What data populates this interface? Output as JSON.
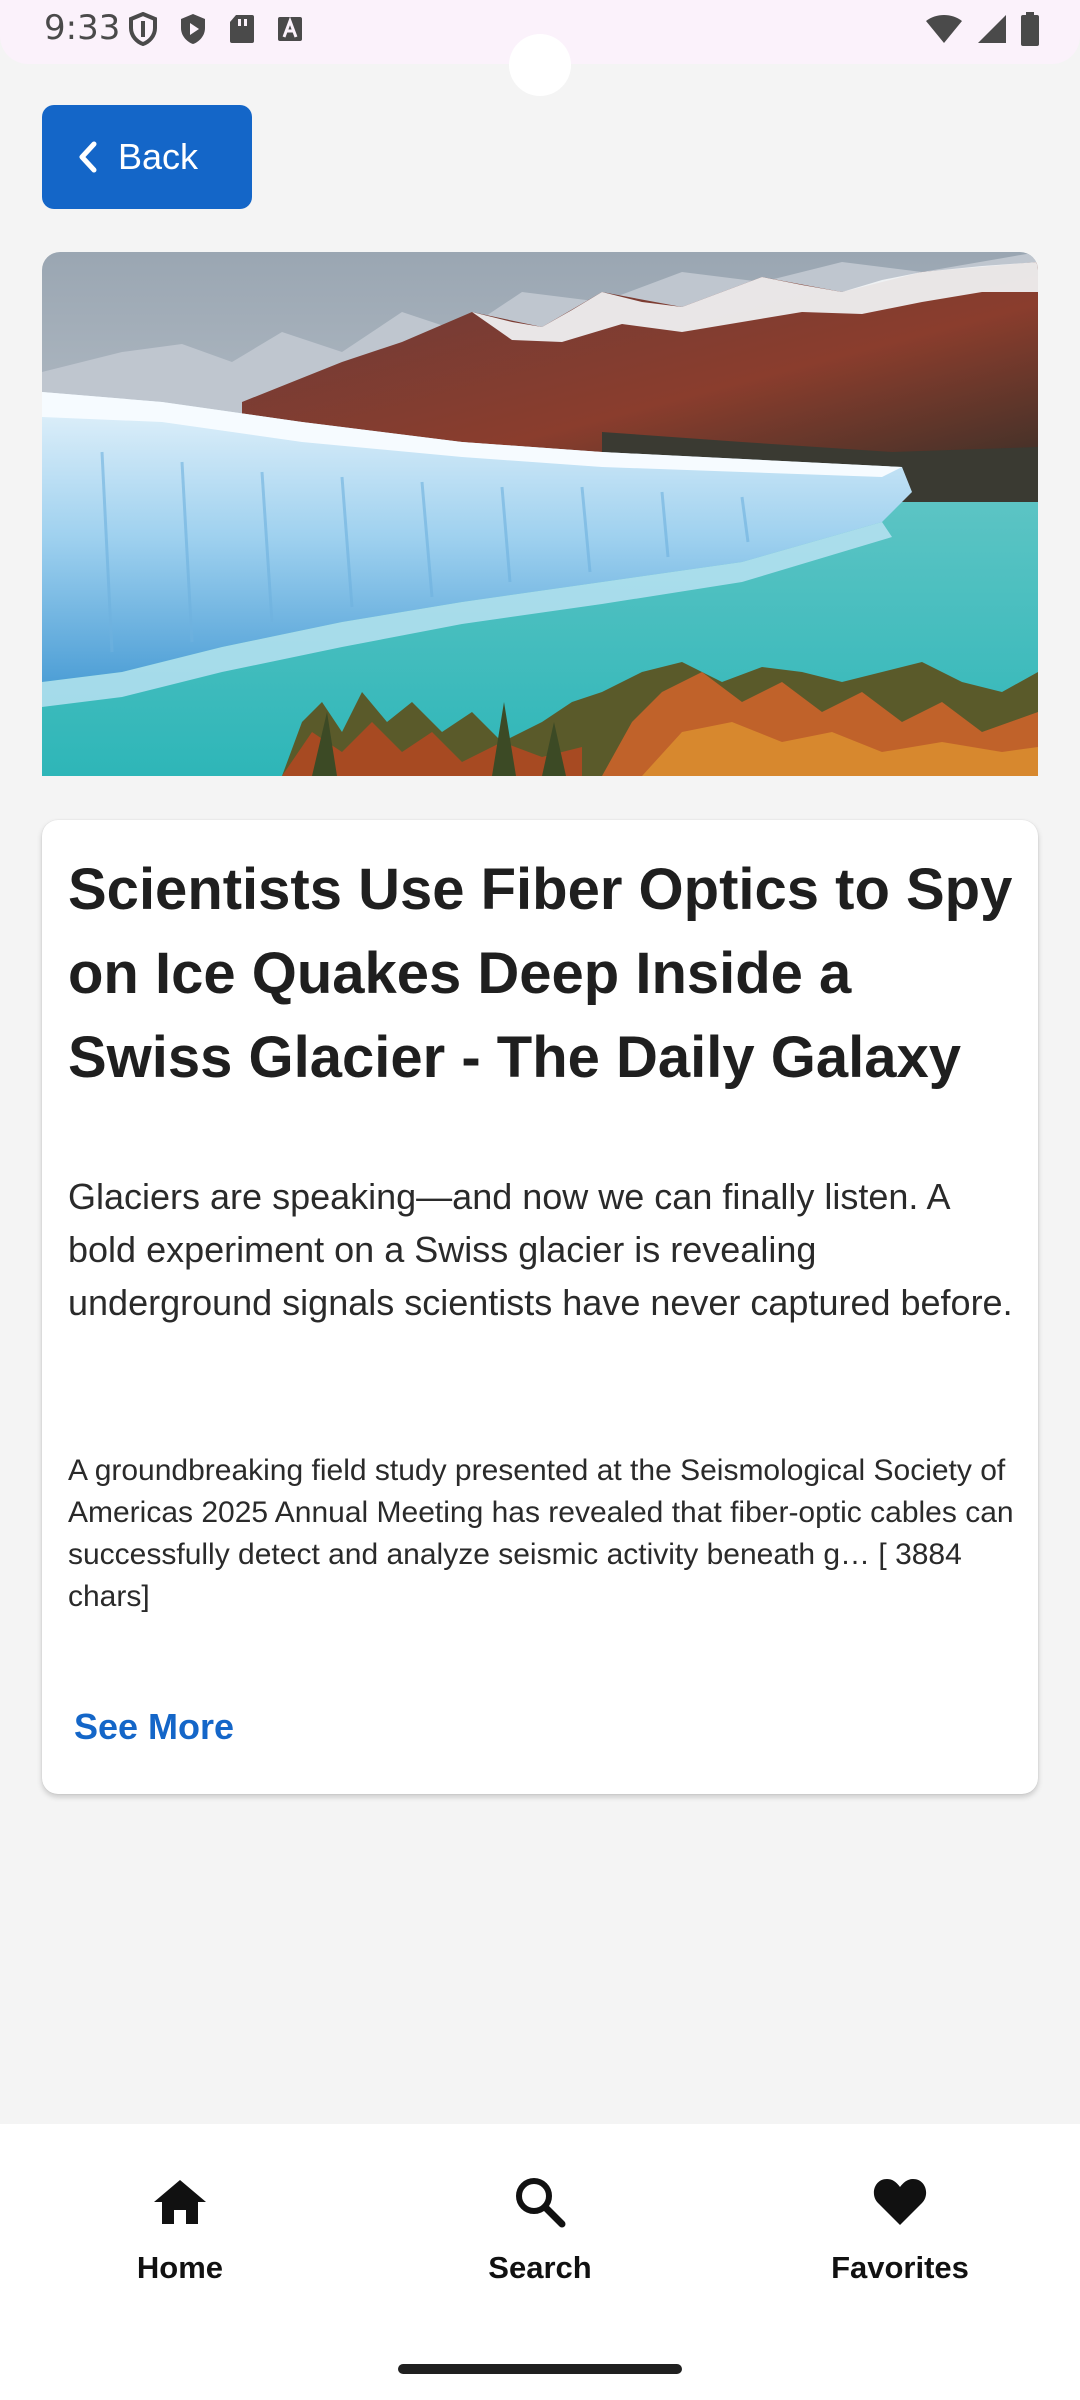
{
  "status_bar": {
    "time": "9:33",
    "left_icons": [
      "shield-icon",
      "play-protect-icon",
      "sd-card-icon",
      "a-box-icon"
    ],
    "right_icons": [
      "wifi-icon",
      "signal-icon",
      "battery-icon"
    ]
  },
  "header": {
    "back_label": "Back"
  },
  "article": {
    "image_icon": "glacier-landscape-image",
    "title": "Scientists Use Fiber Optics to Spy on Ice Quakes Deep Inside a Swiss Glacier - The Daily Galaxy",
    "description": "Glaciers are speaking—and now we can finally listen. A bold experiment on a Swiss glacier is revealing underground signals scientists have never captured before.",
    "content": "A groundbreaking field study presented at the Seismological Society of Americas 2025 Annual Meeting has revealed that fiber-optic cables can successfully detect and analyze seismic activity beneath g… [ 3884 chars]",
    "see_more_label": "See More"
  },
  "bottom_nav": {
    "items": [
      {
        "label": "Home",
        "icon": "home-icon"
      },
      {
        "label": "Search",
        "icon": "search-icon"
      },
      {
        "label": "Favorites",
        "icon": "heart-icon"
      }
    ]
  },
  "colors": {
    "accent": "#1466c8",
    "background": "#f4f4f4",
    "status_bar": "#fbf2fb"
  }
}
